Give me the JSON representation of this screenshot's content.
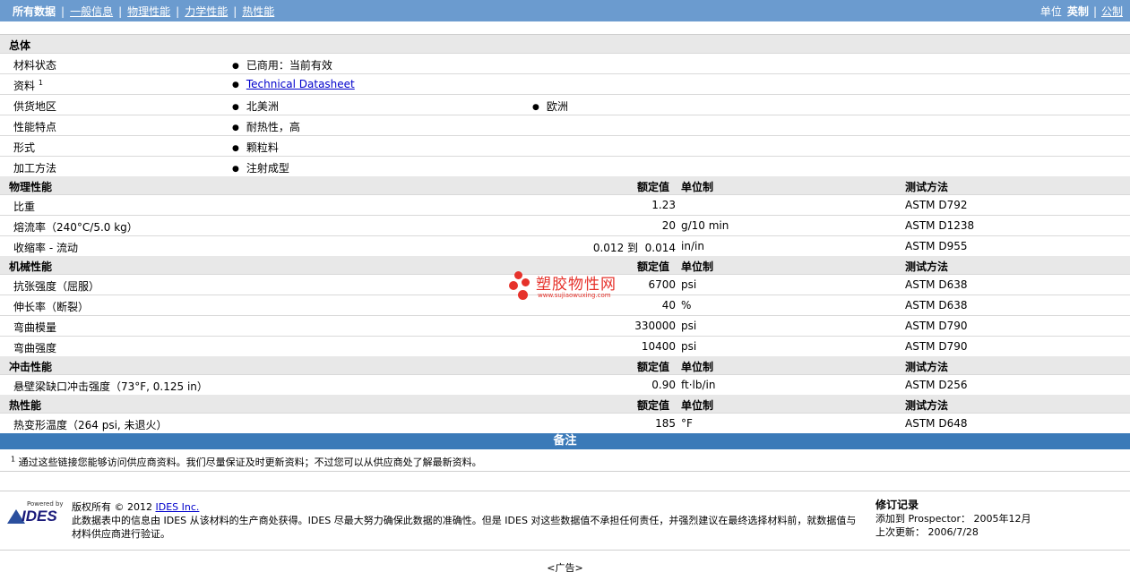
{
  "nav": {
    "tabs": [
      "所有数据",
      "一般信息",
      "物理性能",
      "力学性能",
      "热性能"
    ],
    "units_label": "单位",
    "unit_english": "英制",
    "unit_metric": "公制"
  },
  "general": {
    "title": "总体",
    "rows": [
      {
        "label": "材料状态",
        "values": [
          "已商用：当前有效"
        ]
      },
      {
        "label": "资料",
        "sup": "1",
        "values": [
          "Technical Datasheet"
        ],
        "link": true
      },
      {
        "label": "供货地区",
        "values": [
          "北美洲",
          "欧洲"
        ]
      },
      {
        "label": "性能特点",
        "values": [
          "耐热性，高"
        ]
      },
      {
        "label": "形式",
        "values": [
          "颗粒料"
        ]
      },
      {
        "label": "加工方法",
        "values": [
          "注射成型"
        ]
      }
    ]
  },
  "columns": {
    "nominal": "额定值",
    "unit": "单位制",
    "method": "测试方法"
  },
  "sections": [
    {
      "title": "物理性能",
      "rows": [
        {
          "label": "比重",
          "value": "1.23",
          "unit": "",
          "method": "ASTM D792"
        },
        {
          "label": "熔流率（240°C/5.0 kg）",
          "value": "20",
          "unit": "g/10 min",
          "method": "ASTM D1238"
        },
        {
          "label": "收缩率 - 流动",
          "value": "0.012 到  0.014",
          "unit": "in/in",
          "method": "ASTM D955"
        }
      ]
    },
    {
      "title": "机械性能",
      "rows": [
        {
          "label": "抗张强度（屈服）",
          "value": "6700",
          "unit": "psi",
          "method": "ASTM D638"
        },
        {
          "label": "伸长率（断裂）",
          "value": "40",
          "unit": "%",
          "method": "ASTM D638"
        },
        {
          "label": "弯曲模量",
          "value": "330000",
          "unit": "psi",
          "method": "ASTM D790"
        },
        {
          "label": "弯曲强度",
          "value": "10400",
          "unit": "psi",
          "method": "ASTM D790"
        }
      ]
    },
    {
      "title": "冲击性能",
      "rows": [
        {
          "label": "悬壁梁缺口冲击强度（73°F, 0.125 in）",
          "value": "0.90",
          "unit": "ft·lb/in",
          "method": "ASTM D256"
        }
      ]
    },
    {
      "title": "热性能",
      "rows": [
        {
          "label": "热变形温度（264 psi, 未退火）",
          "value": "185",
          "unit": "°F",
          "method": "ASTM D648"
        }
      ]
    }
  ],
  "notes": {
    "title": "备注",
    "sup": "1",
    "text": "通过这些链接您能够访问供应商资料。我们尽量保证及时更新资料；不过您可以从供应商处了解最新资料。"
  },
  "footer": {
    "powered_by": "Powered by",
    "logo_text": "IDES",
    "copyright_prefix": "版权所有 © 2012 ",
    "copyright_link": "IDES Inc.",
    "disclaimer": "此数据表中的信息由 IDES 从该材料的生产商处获得。IDES 尽最大努力确保此数据的准确性。但是 IDES 对这些数据值不承担任何责任，并强烈建议在最终选择材料前，就数据值与材料供应商进行验证。",
    "revision_title": "修订记录",
    "added_to": "添加到 Prospector： 2005年12月",
    "last_updated": "上次更新： 2006/7/28"
  },
  "ad_text": "<广告>",
  "watermark": {
    "name": "塑胶物性网",
    "url": "www.sujiaowuxing.com"
  },
  "colors": {
    "nav_bg": "#6b9bcf",
    "notes_bg": "#3b7ab8",
    "section_bg": "#e8e8e8",
    "link": "#0000cc",
    "watermark": "#e6322b"
  }
}
